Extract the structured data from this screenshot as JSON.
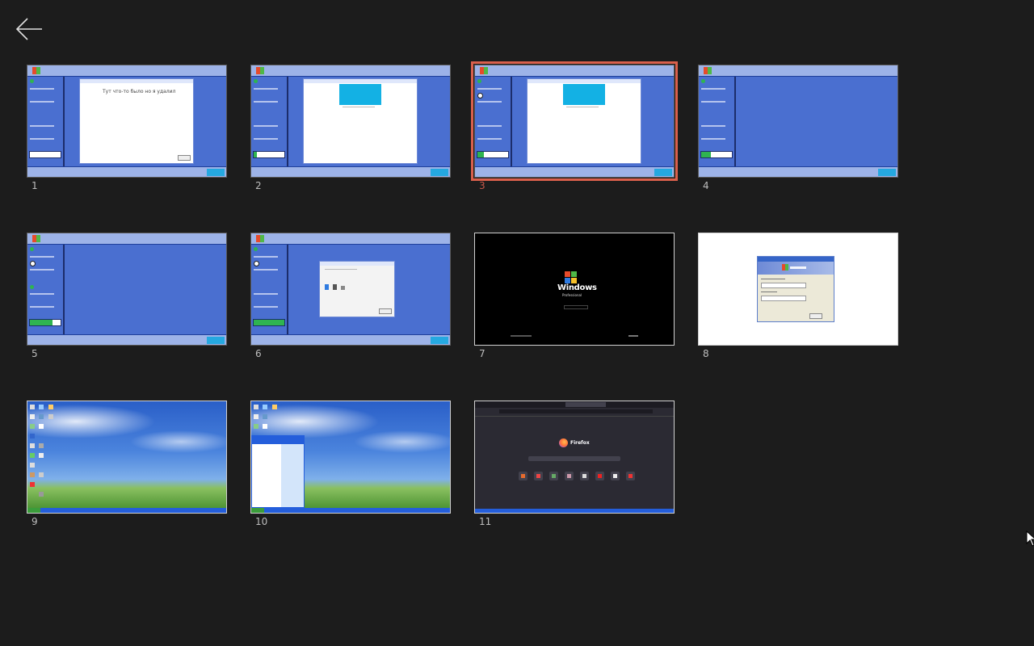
{
  "header": {
    "back_icon": "arrow-left-icon"
  },
  "thumbnails": [
    {
      "number": "1",
      "kind": "setup",
      "caption": "Тут что-то было но я удалил",
      "selected": false
    },
    {
      "number": "2",
      "kind": "setup",
      "selected": false
    },
    {
      "number": "3",
      "kind": "setup",
      "selected": true
    },
    {
      "number": "4",
      "kind": "setup",
      "selected": false
    },
    {
      "number": "5",
      "kind": "setup",
      "selected": false
    },
    {
      "number": "6",
      "kind": "setup",
      "selected": false
    },
    {
      "number": "7",
      "kind": "boot",
      "boot_brand": "Windows",
      "boot_edition": "Professional",
      "selected": false
    },
    {
      "number": "8",
      "kind": "login",
      "selected": false
    },
    {
      "number": "9",
      "kind": "desktop",
      "selected": false
    },
    {
      "number": "10",
      "kind": "desktop-startmenu",
      "selected": false
    },
    {
      "number": "11",
      "kind": "firefox",
      "app_name": "Firefox",
      "selected": false
    }
  ],
  "colors": {
    "background": "#1c1c1c",
    "selection_border": "#d9604c",
    "number_text": "#bdbdbd"
  }
}
